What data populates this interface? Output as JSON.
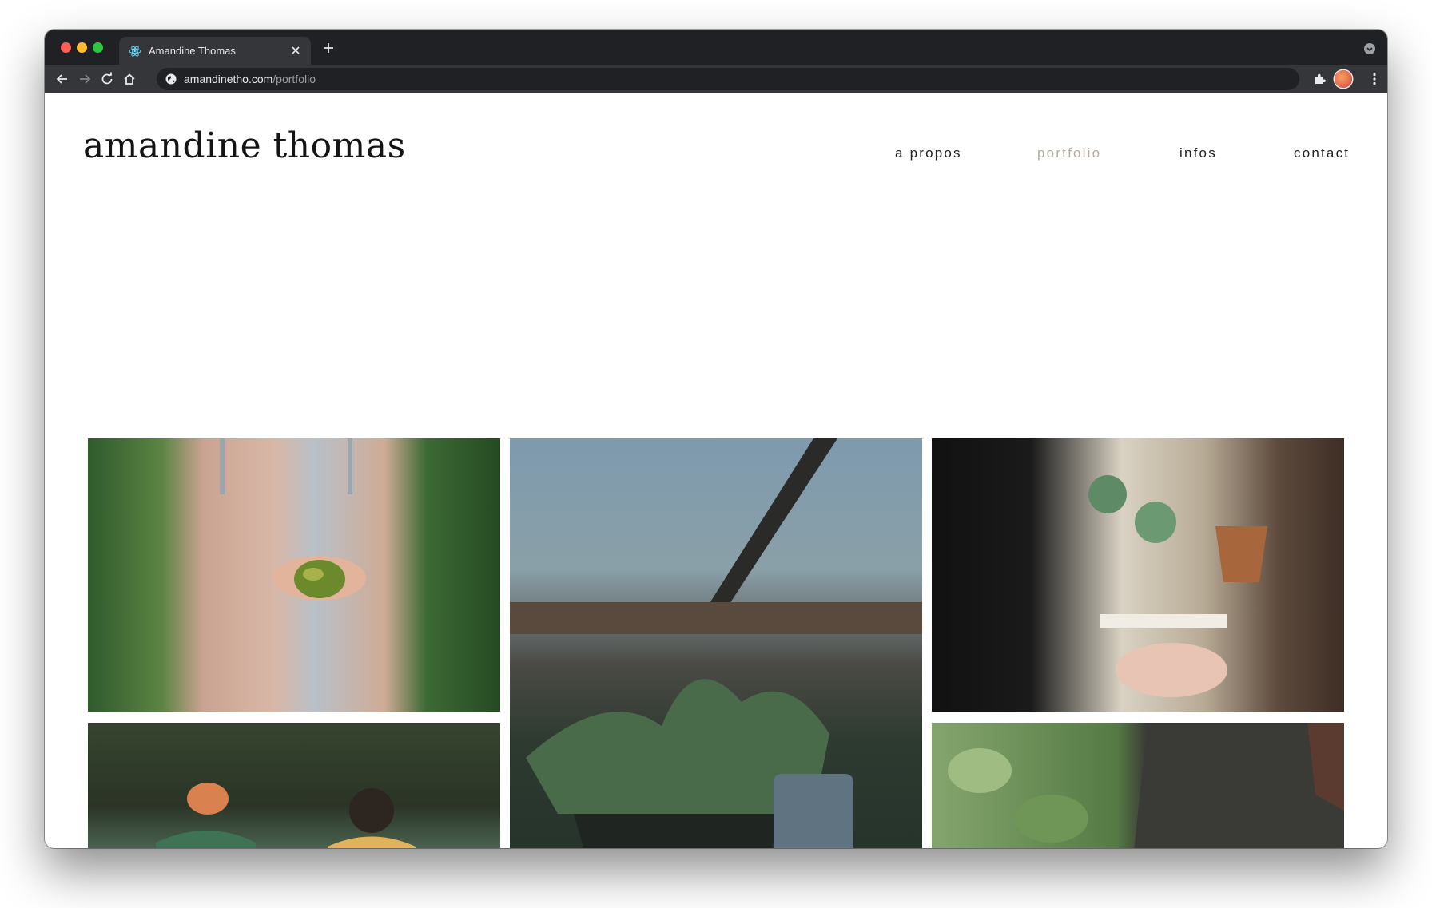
{
  "browser": {
    "tab": {
      "title": "Amandine Thomas"
    },
    "address_bar": {
      "host": "amandinetho.com",
      "path": "/portfolio"
    }
  },
  "site": {
    "brand": "amandine thomas",
    "nav": {
      "a_propos": "a propos",
      "portfolio": "portfolio",
      "infos": "infos",
      "contact": "contact"
    },
    "active_nav": "portfolio",
    "accent_color": "#b3ad9f"
  },
  "gallery": {
    "photos": [
      {
        "subject": "hands holding a green tomato"
      },
      {
        "subject": "potted plants in a greenhouse"
      },
      {
        "subject": "writing plant labels beside succulents"
      },
      {
        "subject": "two women talking outdoors"
      },
      {
        "subject": "greenhouse plants and knit sweater"
      }
    ]
  }
}
